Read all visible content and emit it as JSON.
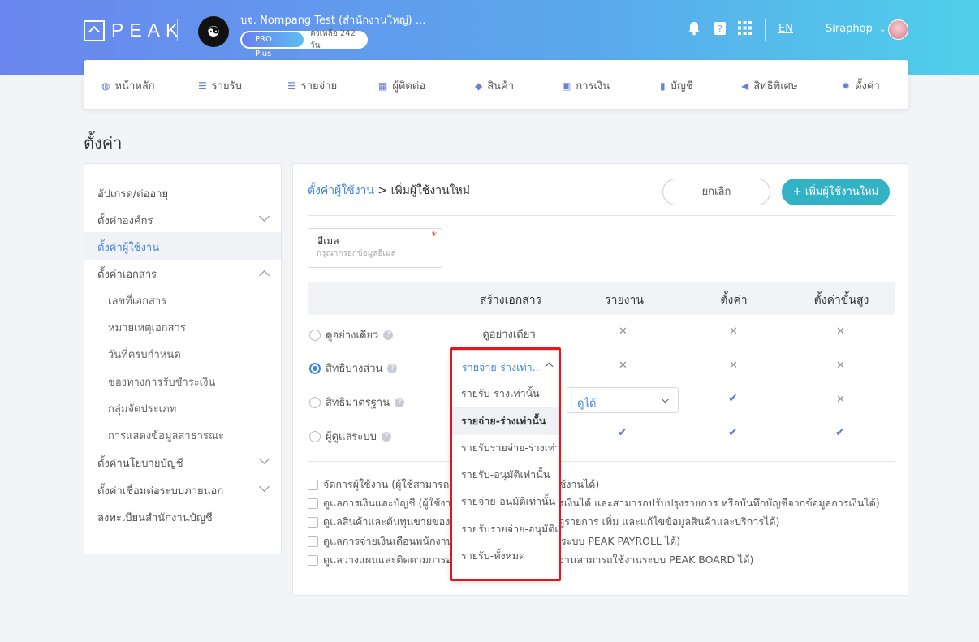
{
  "header": {
    "logo_text": "PEAK",
    "company_name": "บจ. Nompang Test (สำนักงานใหญ่) ...",
    "plan_badge": "PRO Plus",
    "plan_remaining": "คงเหลือ 242 วัน",
    "language": "EN",
    "user_name": "Siraphop",
    "icons": [
      "bell-icon",
      "help-book-icon",
      "apps-grid-icon"
    ]
  },
  "nav": {
    "items": [
      {
        "label": "หน้าหลัก",
        "icon": "dashboard-icon"
      },
      {
        "label": "รายรับ",
        "icon": "income-icon"
      },
      {
        "label": "รายจ่าย",
        "icon": "expense-icon"
      },
      {
        "label": "ผู้ติดต่อ",
        "icon": "contacts-icon"
      },
      {
        "label": "สินค้า",
        "icon": "box-icon"
      },
      {
        "label": "การเงิน",
        "icon": "money-icon"
      },
      {
        "label": "บัญชี",
        "icon": "book-icon"
      },
      {
        "label": "สิทธิพิเศษ",
        "icon": "megaphone-icon"
      },
      {
        "label": "ตั้งค่า",
        "icon": "gear-icon"
      }
    ]
  },
  "page": {
    "title": "ตั้งค่า"
  },
  "sidebar": {
    "items": [
      {
        "label": "อัปเกรด/ต่ออายุ"
      },
      {
        "label": "ตั้งค่าองค์กร"
      },
      {
        "label": "ตั้งค่าผู้ใช้งาน"
      },
      {
        "label": "ตั้งค่าเอกสาร"
      },
      {
        "label": "เลขที่เอกสาร"
      },
      {
        "label": "หมายเหตุเอกสาร"
      },
      {
        "label": "วันที่ครบกำหนด"
      },
      {
        "label": "ช่องทางการรับชำระเงิน"
      },
      {
        "label": "กลุ่มจัดประเภท"
      },
      {
        "label": "การแสดงข้อมูลสาธารณะ"
      },
      {
        "label": "ตั้งค่านโยบายบัญชี"
      },
      {
        "label": "ตั้งค่าเชื่อมต่อระบบภายนอก"
      },
      {
        "label": "ลงทะเบียนสำนักงานบัญชี"
      }
    ]
  },
  "main": {
    "breadcrumb_link": "ตั้งค่าผู้ใช้งาน",
    "breadcrumb_sep": " > ",
    "breadcrumb_current": "เพิ่มผู้ใช้งานใหม่",
    "cancel_label": "ยกเลิก",
    "add_label": "+ เพิ่มผู้ใช้งานใหม่",
    "email": {
      "label": "อีเมล",
      "required_mark": "*",
      "placeholder": "กรุณากรอกข้อมูลอีเมล",
      "value": ""
    },
    "table": {
      "headers": [
        "สร้างเอกสาร",
        "รายงาน",
        "ตั้งค่า",
        "ตั้งค่าขั้นสูง"
      ],
      "rows": [
        {
          "label": "ดูอย่างเดียว",
          "checked": false,
          "create_doc": "ดูอย่างเดียว"
        },
        {
          "label": "สิทธิบางส่วน",
          "checked": true
        },
        {
          "label": "สิทธิมาตรฐาน",
          "checked": false,
          "report_value": "ดูได้"
        },
        {
          "label": "ผู้ดูแลระบบ",
          "checked": false
        }
      ]
    },
    "checkboxes": [
      "จัดการผู้ใช้งาน (ผู้ใช้สามารถกำหนดสิทธิและจัดการผู้ใช้งานได้)",
      "ดูแลการเงินและบัญชี (ผู้ใช้งานสามารถเข้าถึงข้อมูลการเงินได้ และสามารถปรับปรุงรายการ หรือบันทึกบัญชีจากข้อมูลการเงินได้)",
      "ดูแลสินค้าและต้นทุนขายของกิจการ (ผู้ใช้งานสามารถดูรายการ เพิ่ม และแก้ไขข้อมูลสินค้าและบริการได้)",
      "ดูแลการจ่ายเงินเดือนพนักงาน (ผู้ใช้งานสามารถใช้งานระบบ PEAK PAYROLL ได้)",
      "ดูแลวางแผนและติดตามการออกแบบงบประมาณ (ผู้ใช้งานสามารถใช้งานระบบ PEAK BOARD ได้)"
    ]
  },
  "dropdown": {
    "selected": "รายจ่าย-ร่างเท่า...",
    "options": [
      "รายรับ-ร่างเท่านั้น",
      "รายจ่าย-ร่างเท่านั้น",
      "รายรับรายจ่าย-ร่างเท่านั้น",
      "รายรับ-อนุมัติเท่านั้น",
      "รายจ่าย-อนุมัติเท่านั้น",
      "รายรับรายจ่าย-อนุมัติเท่านั้น",
      "รายรับ-ทั้งหมด"
    ],
    "active_index": 1,
    "highlight_color": "#e8141d"
  },
  "colors": {
    "accent": "#3f86e0",
    "primary_button": "#32b2c5",
    "check": "#5c73d6"
  }
}
